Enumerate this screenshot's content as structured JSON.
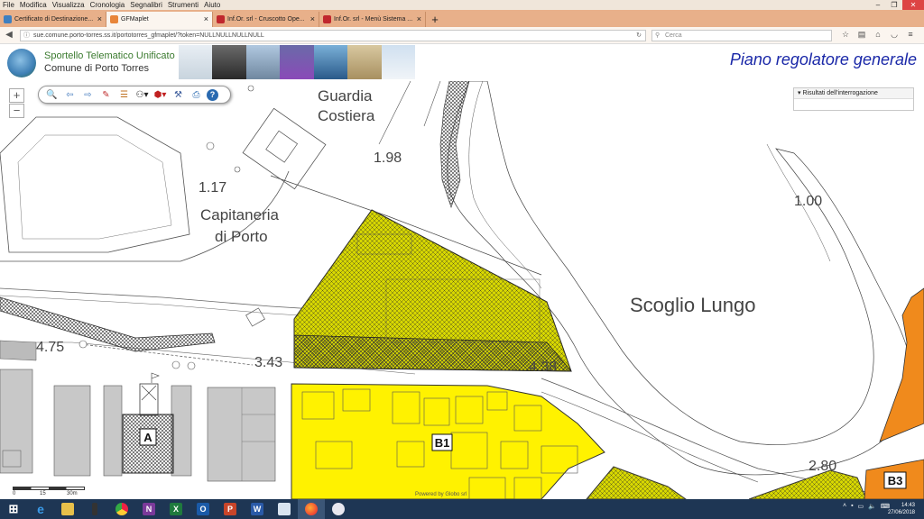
{
  "browser": {
    "menu": [
      "File",
      "Modifica",
      "Visualizza",
      "Cronologia",
      "Segnalibri",
      "Strumenti",
      "Aiuto"
    ],
    "tabs": [
      {
        "label": "Certificato di Destinazione...",
        "color": "#3f7fc0"
      },
      {
        "label": "GFMaplet",
        "color": "#e8853a"
      },
      {
        "label": "Inf.Or. srl - Cruscotto Ope...",
        "color": "#c0272d"
      },
      {
        "label": "Inf.Or. srl - Menù Sistema ...",
        "color": "#c0272d"
      }
    ],
    "url_host": "sue.comune.porto-torres.ss.it",
    "url": "sue.comune.porto-torres.ss.it/portotorres_gfmaplet/?token=NULLNULLNULLNULL",
    "search_placeholder": "Cerca"
  },
  "header": {
    "logo_line1": "Sportello Telematico Unificato",
    "logo_line2": "Comune di Porto Torres",
    "title": "Piano regolatore generale"
  },
  "map": {
    "labels": {
      "guardia": "Guardia",
      "costiera": "Costiera",
      "capitaneria": "Capitaneria",
      "di_porto": "di Porto",
      "scoglio": "Scoglio Lungo",
      "v198": "1.98",
      "v117": "1.17",
      "v100": "1.00",
      "v475": "4.75",
      "v343": "3.43",
      "v438": "4.38",
      "v280": "2.80"
    },
    "zones": {
      "a": "A",
      "b1": "B1",
      "b3": "B3"
    },
    "zoom_in": "+",
    "zoom_out": "−",
    "scale": {
      "s0": "0",
      "s15": "15",
      "s30": "30m"
    },
    "powered": "Powered by Globo srl",
    "colors": {
      "yellow": "#fff200",
      "olive": "#d8d800",
      "orange": "#f08a1c",
      "gray": "#c8c8c8"
    }
  },
  "results_panel": {
    "header": "Risultati dell'interrogazione"
  },
  "taskbar": {
    "time": "14:43",
    "date": "27/06/2018"
  }
}
